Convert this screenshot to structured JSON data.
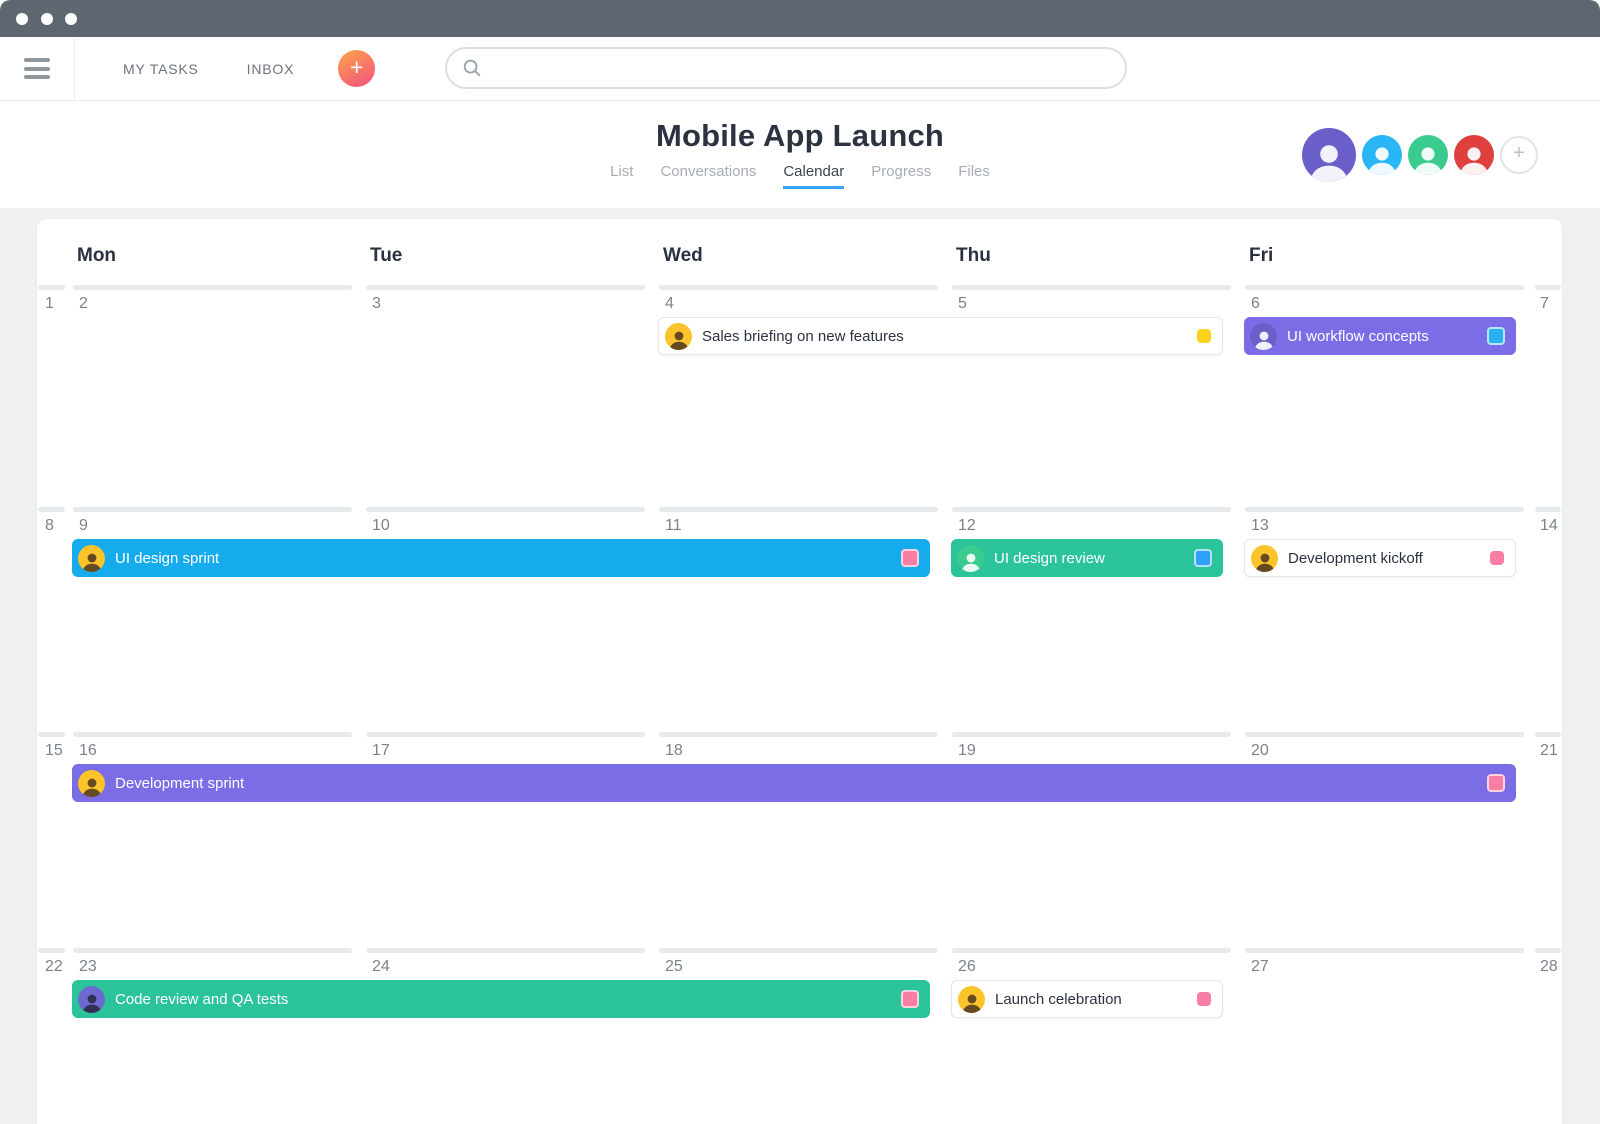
{
  "navbar": {
    "menu_items": [
      {
        "label": "MY TASKS"
      },
      {
        "label": "INBOX"
      }
    ],
    "add_button_label": "+",
    "search": {
      "placeholder": ""
    }
  },
  "header": {
    "title": "Mobile App Launch",
    "tabs": [
      {
        "label": "List",
        "active": false
      },
      {
        "label": "Conversations",
        "active": false
      },
      {
        "label": "Calendar",
        "active": true
      },
      {
        "label": "Progress",
        "active": false
      },
      {
        "label": "Files",
        "active": false
      }
    ],
    "members": {
      "avatar_colors": [
        "#6a5fc9",
        "#29b6f6",
        "#3bcb8e",
        "#e0403d"
      ],
      "add_member_label": "+"
    }
  },
  "calendar": {
    "day_headers": [
      "Mon",
      "Tue",
      "Wed",
      "Thu",
      "Fri"
    ],
    "weeks": [
      {
        "left_date": "1",
        "dates": [
          "2",
          "3",
          "4",
          "5",
          "6"
        ],
        "right_date": "7",
        "events": [
          {
            "title": "Sales briefing on new features",
            "start_day": "Wed",
            "days": 2,
            "variant": "white",
            "avatar_color": "#fcc32b",
            "marker_color": "#fdd31c"
          },
          {
            "title": "UI workflow concepts",
            "start_day": "Fri",
            "days": 1,
            "variant": "purple",
            "avatar_color": "#6a5fc9",
            "marker_color": "#29b2f1"
          }
        ]
      },
      {
        "left_date": "8",
        "dates": [
          "9",
          "10",
          "11",
          "12",
          "13"
        ],
        "right_date": "14",
        "events": [
          {
            "title": "UI design sprint",
            "start_day": "Mon",
            "days": 3,
            "variant": "blue",
            "avatar_color": "#fcc32b",
            "marker_color": "#f97ea4"
          },
          {
            "title": "UI design review",
            "start_day": "Thu",
            "days": 1,
            "variant": "green",
            "avatar_color": "#3bcb8e",
            "marker_color": "#2da3f7"
          },
          {
            "title": "Development kickoff",
            "start_day": "Fri",
            "days": 1,
            "variant": "white",
            "avatar_color": "#fcc32b",
            "marker_color": "#f97ea4"
          }
        ]
      },
      {
        "left_date": "15",
        "dates": [
          "16",
          "17",
          "18",
          "19",
          "20"
        ],
        "right_date": "21",
        "events": [
          {
            "title": "Development sprint",
            "start_day": "Mon",
            "days": 5,
            "variant": "purple",
            "avatar_color": "#fcc32b",
            "marker_color": "#f97ea4"
          }
        ]
      },
      {
        "left_date": "22",
        "dates": [
          "23",
          "24",
          "25",
          "26",
          "27"
        ],
        "right_date": "28",
        "events": [
          {
            "title": "Code review and QA tests",
            "start_day": "Mon",
            "days": 3,
            "variant": "green",
            "avatar_color": "#6f68d1",
            "marker_color": "#f97ea4"
          },
          {
            "title": "Launch celebration",
            "start_day": "Thu",
            "days": 1,
            "variant": "white",
            "avatar_color": "#fcc32b",
            "marker_color": "#f97ea4"
          }
        ]
      }
    ]
  },
  "colors": {
    "chrome_bar": "#5e666f",
    "tab_accent": "#3aa4f6",
    "event_blue": "#16abec",
    "event_green": "#2bc49a",
    "event_purple": "#7b6de6",
    "add_button_gradient": [
      "#fca14b",
      "#f4547e"
    ]
  }
}
